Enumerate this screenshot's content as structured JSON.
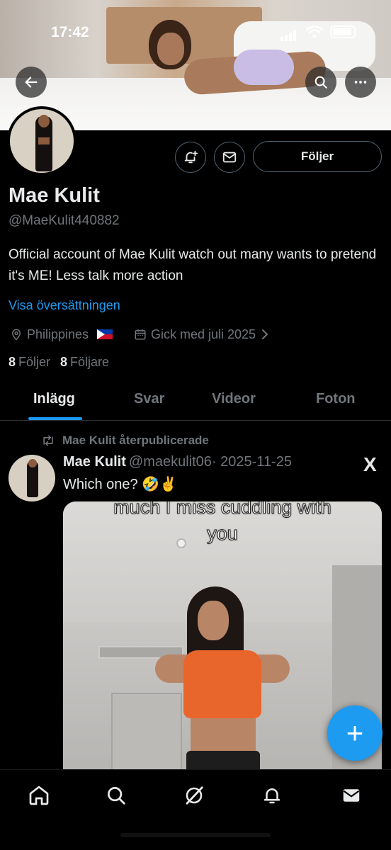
{
  "status_bar": {
    "time": "17:42"
  },
  "profile": {
    "name": "Mae Kulit",
    "handle": "@MaeKulit440882",
    "bio": "Official account of Mae Kulit watch out many wants to pretend it's ME! Less talk more action",
    "translate_link": "Visa översättningen",
    "location": "Philippines",
    "joined": "Gick med juli 2025",
    "following_count": "8",
    "following_label": "Följer",
    "followers_count": "8",
    "followers_label": "Följare",
    "follow_button_label": "Följer"
  },
  "tabs": [
    {
      "label": "Inlägg",
      "active": true
    },
    {
      "label": "Svar",
      "active": false
    },
    {
      "label": "Videor",
      "active": false
    },
    {
      "label": "Foton",
      "active": false
    }
  ],
  "post": {
    "repost_label": "Mae Kulit återpublicerade",
    "author_name": "Mae Kulit",
    "author_handle": "@maekulit06",
    "date": "· 2025-11-25",
    "text": "Which one? 🤣✌️",
    "media_caption_line1": "much I miss cuddling with",
    "media_caption_line2": "you",
    "source_logo": "X"
  },
  "fab_label": "+",
  "icons": {
    "back": "arrow-left-icon",
    "search": "search-icon",
    "more": "more-horizontal-icon",
    "notify": "bell-plus-icon",
    "message": "envelope-icon",
    "location": "location-pin-icon",
    "calendar": "calendar-icon",
    "repost": "repost-icon",
    "nav": [
      "home-icon",
      "search-icon",
      "grok-icon",
      "notifications-icon",
      "messages-icon"
    ]
  },
  "colors": {
    "accent": "#1d9bf0",
    "background": "#000000",
    "muted": "#71767b",
    "text": "#e7e9ea"
  }
}
